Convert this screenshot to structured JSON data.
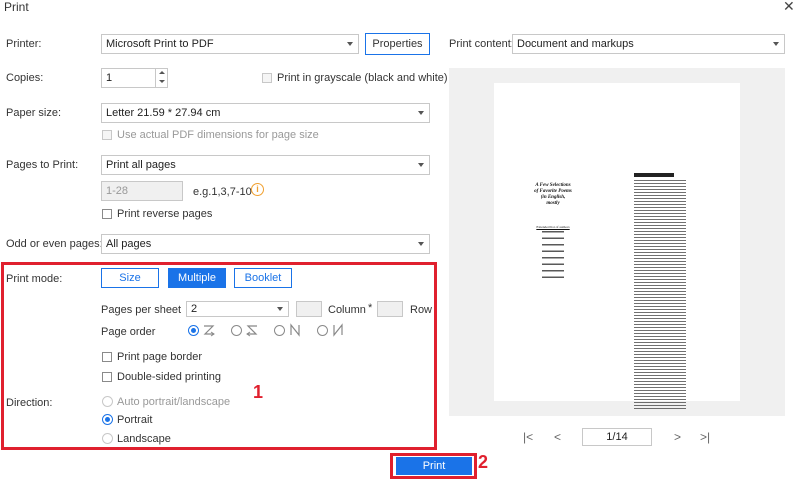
{
  "window": {
    "title": "Print",
    "close_icon": "close-icon"
  },
  "printer": {
    "label": "Printer:",
    "value": "Microsoft Print to PDF",
    "properties_label": "Properties"
  },
  "copies": {
    "label": "Copies:",
    "value": "1"
  },
  "grayscale": {
    "label": "Print in grayscale (black and white)",
    "checked": false
  },
  "paper_size": {
    "label": "Paper size:",
    "value": "Letter 21.59 * 27.94 cm",
    "actual_dims_label": "Use actual PDF dimensions for page size"
  },
  "pages_to_print": {
    "label": "Pages to Print:",
    "value": "Print all pages",
    "range_placeholder": "1-28",
    "range_hint": "e.g.1,3,7-10",
    "reverse_label": "Print reverse pages"
  },
  "odd_even": {
    "label": "Odd or even pages:",
    "value": "All pages"
  },
  "print_mode": {
    "label": "Print mode:",
    "buttons": [
      "Size",
      "Multiple",
      "Booklet"
    ],
    "active": "Multiple",
    "pages_per_sheet_label": "Pages per sheet",
    "pages_per_sheet_value": "2",
    "column_label": "Column",
    "times": "*",
    "row_label": "Row",
    "page_order_label": "Page order",
    "page_order_icons": [
      "z-order-icon",
      "reverse-z-order-icon",
      "n-order-icon",
      "reverse-n-order-icon"
    ],
    "page_border_label": "Print page border",
    "double_sided_label": "Double-sided printing"
  },
  "direction": {
    "label": "Direction:",
    "options": [
      "Auto portrait/landscape",
      "Portrait",
      "Landscape"
    ],
    "selected": "Portrait"
  },
  "print_content": {
    "label": "Print content:",
    "value": "Document and markups"
  },
  "preview": {
    "page_indicator": "1/14",
    "left_title": "A Few Selections of Favorite Poems (in English, mostly",
    "left_subheading": "Extended list of authors"
  },
  "annotations": {
    "box1": "1",
    "box2": "2"
  },
  "print_button": {
    "label": "Print"
  },
  "colors": {
    "accent": "#1a73e8",
    "annotation": "#e0202e"
  }
}
